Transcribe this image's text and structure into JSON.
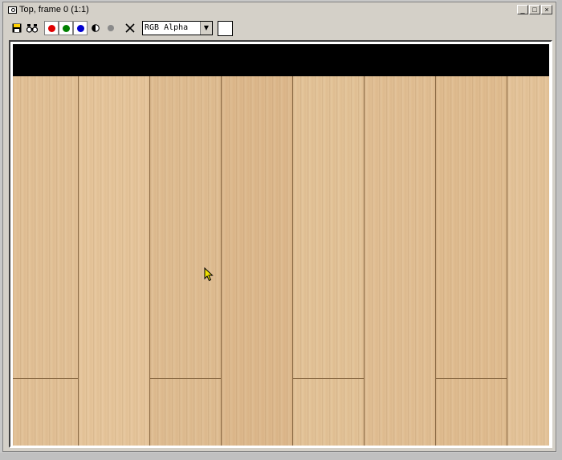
{
  "window": {
    "title": "Top, frame 0 (1:1)",
    "controls": {
      "minimize": "_",
      "maximize": "□",
      "close": "×"
    }
  },
  "toolbar": {
    "save_icon": "floppy-disk-icon",
    "clone_icon": "binoculars-icon",
    "channels": [
      {
        "name": "red-channel",
        "color": "#e00000"
      },
      {
        "name": "green-channel",
        "color": "#008000"
      },
      {
        "name": "blue-channel",
        "color": "#0000d0"
      }
    ],
    "mono_icon": "half-circle-icon",
    "alpha_icon": "gray-circle-icon",
    "clear_icon": "x-icon",
    "channel_select": {
      "value": "RGB Alpha",
      "arrow": "▼"
    },
    "color_swatch": "#ffffff"
  },
  "render": {
    "background_top": "#000000",
    "wood_color": "#e2c197",
    "seam_color": "#8a6a44"
  }
}
